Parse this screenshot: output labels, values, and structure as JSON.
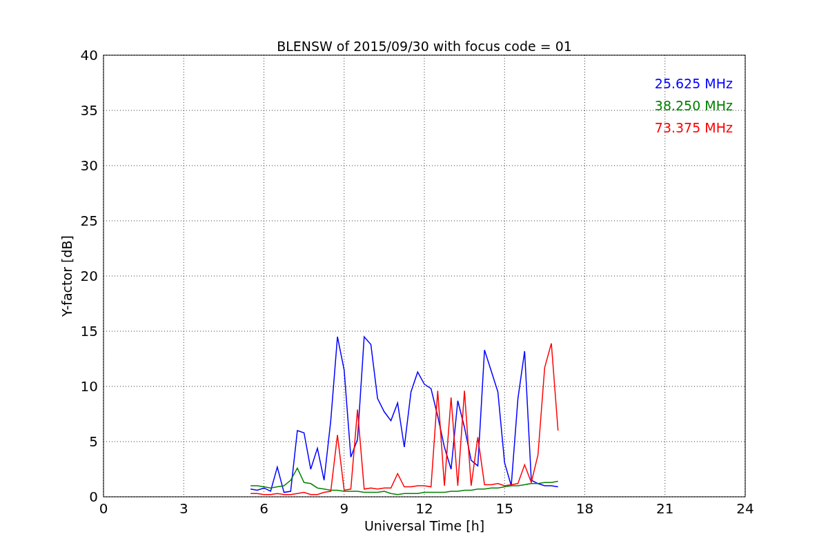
{
  "chart": {
    "chart_data": {
      "type": "line",
      "grid": true,
      "title": "BLENSW of 2015/09/30 with focus code = 01",
      "xlabel": "Universal Time [h]",
      "ylabel": "Y-factor [dB]",
      "xlim": [
        0,
        24
      ],
      "ylim": [
        0,
        40
      ],
      "xticks": [
        0,
        3,
        6,
        9,
        12,
        15,
        18,
        21,
        24
      ],
      "yticks": [
        0,
        5,
        10,
        15,
        20,
        25,
        30,
        35,
        40
      ],
      "x": [
        5.5,
        5.75,
        6.0,
        6.25,
        6.5,
        6.75,
        7.0,
        7.25,
        7.5,
        7.75,
        8.0,
        8.25,
        8.5,
        8.75,
        9.0,
        9.25,
        9.5,
        9.75,
        10.0,
        10.25,
        10.5,
        10.75,
        11.0,
        11.25,
        11.5,
        11.75,
        12.0,
        12.25,
        12.5,
        12.75,
        13.0,
        13.25,
        13.5,
        13.75,
        14.0,
        14.25,
        14.5,
        14.75,
        15.0,
        15.25,
        15.5,
        15.75,
        16.0,
        16.25,
        16.5,
        16.75,
        17.0
      ],
      "series": [
        {
          "name": "25.625 MHz",
          "color": "#0000ff",
          "values": [
            0.7,
            0.6,
            0.8,
            0.5,
            2.7,
            0.4,
            0.5,
            6.0,
            5.8,
            2.5,
            4.4,
            1.5,
            6.9,
            14.5,
            11.5,
            3.6,
            5.2,
            14.5,
            13.8,
            8.9,
            7.7,
            6.9,
            8.5,
            4.5,
            9.5,
            11.3,
            10.2,
            9.8,
            7.3,
            4.5,
            2.5,
            8.7,
            6.3,
            3.3,
            2.8,
            13.3,
            11.4,
            9.5,
            3.1,
            1.0,
            8.9,
            13.2,
            1.5,
            1.2,
            1.0,
            1.0,
            0.9
          ]
        },
        {
          "name": "38.250 MHz",
          "color": "#008000",
          "values": [
            1.0,
            1.0,
            0.9,
            0.8,
            0.9,
            1.0,
            1.5,
            2.6,
            1.3,
            1.2,
            0.8,
            0.7,
            0.6,
            0.6,
            0.5,
            0.5,
            0.5,
            0.4,
            0.4,
            0.4,
            0.5,
            0.3,
            0.2,
            0.3,
            0.3,
            0.3,
            0.4,
            0.4,
            0.4,
            0.4,
            0.5,
            0.5,
            0.6,
            0.6,
            0.7,
            0.7,
            0.8,
            0.8,
            0.9,
            1.0,
            1.0,
            1.1,
            1.2,
            1.2,
            1.3,
            1.3,
            1.4
          ]
        },
        {
          "name": "73.375 MHz",
          "color": "#ff0000",
          "values": [
            0.3,
            0.3,
            0.2,
            0.2,
            0.3,
            0.2,
            0.2,
            0.3,
            0.4,
            0.2,
            0.2,
            0.4,
            0.5,
            5.6,
            0.6,
            0.7,
            7.9,
            0.7,
            0.8,
            0.7,
            0.8,
            0.8,
            2.1,
            0.9,
            0.9,
            1.0,
            1.0,
            0.9,
            9.6,
            1.0,
            9.0,
            1.0,
            9.6,
            1.0,
            5.4,
            1.1,
            1.1,
            1.2,
            1.0,
            1.1,
            1.2,
            2.9,
            1.3,
            3.8,
            11.7,
            13.9,
            6.0
          ]
        }
      ]
    }
  }
}
